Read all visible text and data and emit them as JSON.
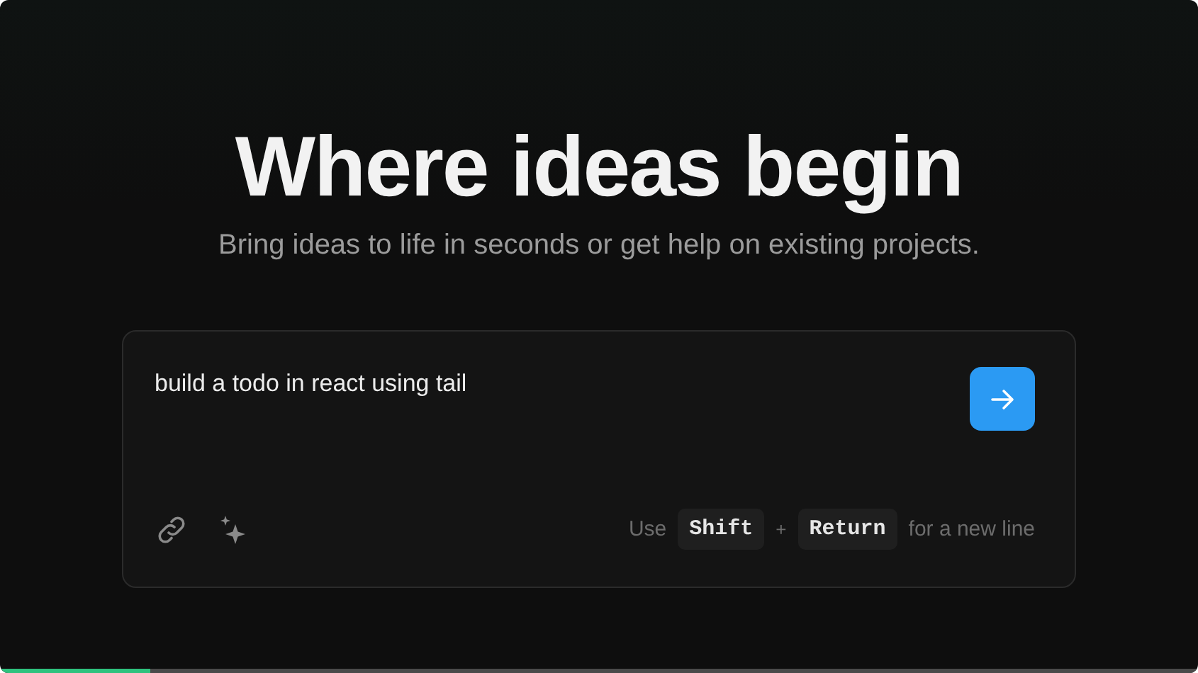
{
  "hero": {
    "title": "Where ideas begin",
    "subtitle": "Bring ideas to life in seconds or get help on existing projects."
  },
  "prompt": {
    "value": "build a todo in react using tail",
    "hint": [
      {
        "kind": "text",
        "text": "Use"
      },
      {
        "kind": "key",
        "text": "Shift"
      },
      {
        "kind": "text",
        "text": "+"
      },
      {
        "kind": "key",
        "text": "Return"
      },
      {
        "kind": "text",
        "text": "for a new line"
      }
    ]
  },
  "progress": {
    "level": 0.125
  }
}
